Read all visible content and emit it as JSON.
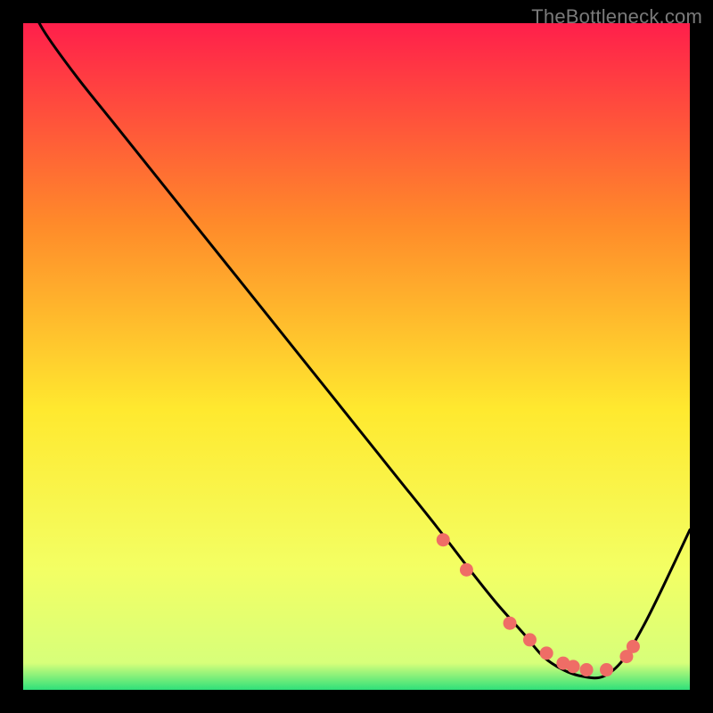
{
  "watermark": "TheBottleneck.com",
  "colors": {
    "bg": "#000000",
    "curve": "#000000",
    "marker": "#ef6d66",
    "watermark": "#7a7a7a",
    "gradient_top": "#ff1f4b",
    "gradient_mid1": "#ff8a2a",
    "gradient_mid2": "#ffe92f",
    "gradient_mid3": "#f3ff64",
    "gradient_bottom": "#2fe07a"
  },
  "chart_data": {
    "type": "line",
    "title": "",
    "xlabel": "",
    "ylabel": "",
    "xlim": [
      0,
      100
    ],
    "ylim": [
      0,
      100
    ],
    "x": [
      0,
      3,
      8,
      14,
      20,
      26,
      32,
      38,
      44,
      50,
      56,
      62,
      67,
      71,
      75,
      78,
      81,
      84,
      87,
      90,
      93,
      96,
      100
    ],
    "values": [
      105,
      99,
      92,
      84.5,
      77,
      69.5,
      62,
      54.5,
      47,
      39.5,
      32,
      24.5,
      18,
      13,
      8.5,
      5,
      3,
      2,
      2,
      4.5,
      9.5,
      15.5,
      24
    ],
    "markers": {
      "x": [
        63,
        66.5,
        73,
        76,
        78.5,
        81,
        82.5,
        84.5,
        87.5,
        90.5,
        91.5
      ],
      "y": [
        22.5,
        18,
        10,
        7.5,
        5.5,
        4,
        3.5,
        3,
        3,
        5,
        6.5
      ]
    }
  }
}
